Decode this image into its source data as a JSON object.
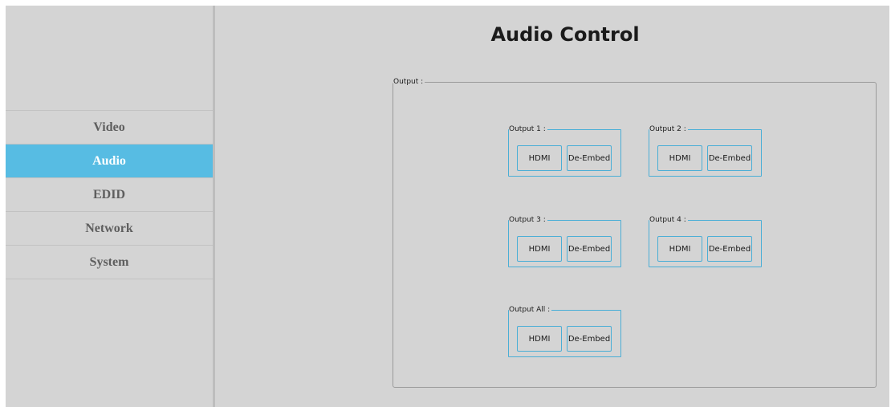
{
  "title": "Audio Control",
  "nav": {
    "items": [
      {
        "label": "Video",
        "active": false
      },
      {
        "label": "Audio",
        "active": true
      },
      {
        "label": "EDID",
        "active": false
      },
      {
        "label": "Network",
        "active": false
      },
      {
        "label": "System",
        "active": false
      }
    ]
  },
  "output_group": {
    "legend": "Output :",
    "outputs": [
      {
        "legend": "Output 1 :",
        "hdmi_label": "HDMI",
        "deembed_label": "De-Embed"
      },
      {
        "legend": "Output 2 :",
        "hdmi_label": "HDMI",
        "deembed_label": "De-Embed"
      },
      {
        "legend": "Output 3 :",
        "hdmi_label": "HDMI",
        "deembed_label": "De-Embed"
      },
      {
        "legend": "Output 4 :",
        "hdmi_label": "HDMI",
        "deembed_label": "De-Embed"
      },
      {
        "legend": "Output All :",
        "hdmi_label": "HDMI",
        "deembed_label": "De-Embed"
      }
    ]
  },
  "colors": {
    "accent": "#57bce3",
    "panel_bg": "#d4d4d4",
    "button_border": "#4aaed6"
  }
}
